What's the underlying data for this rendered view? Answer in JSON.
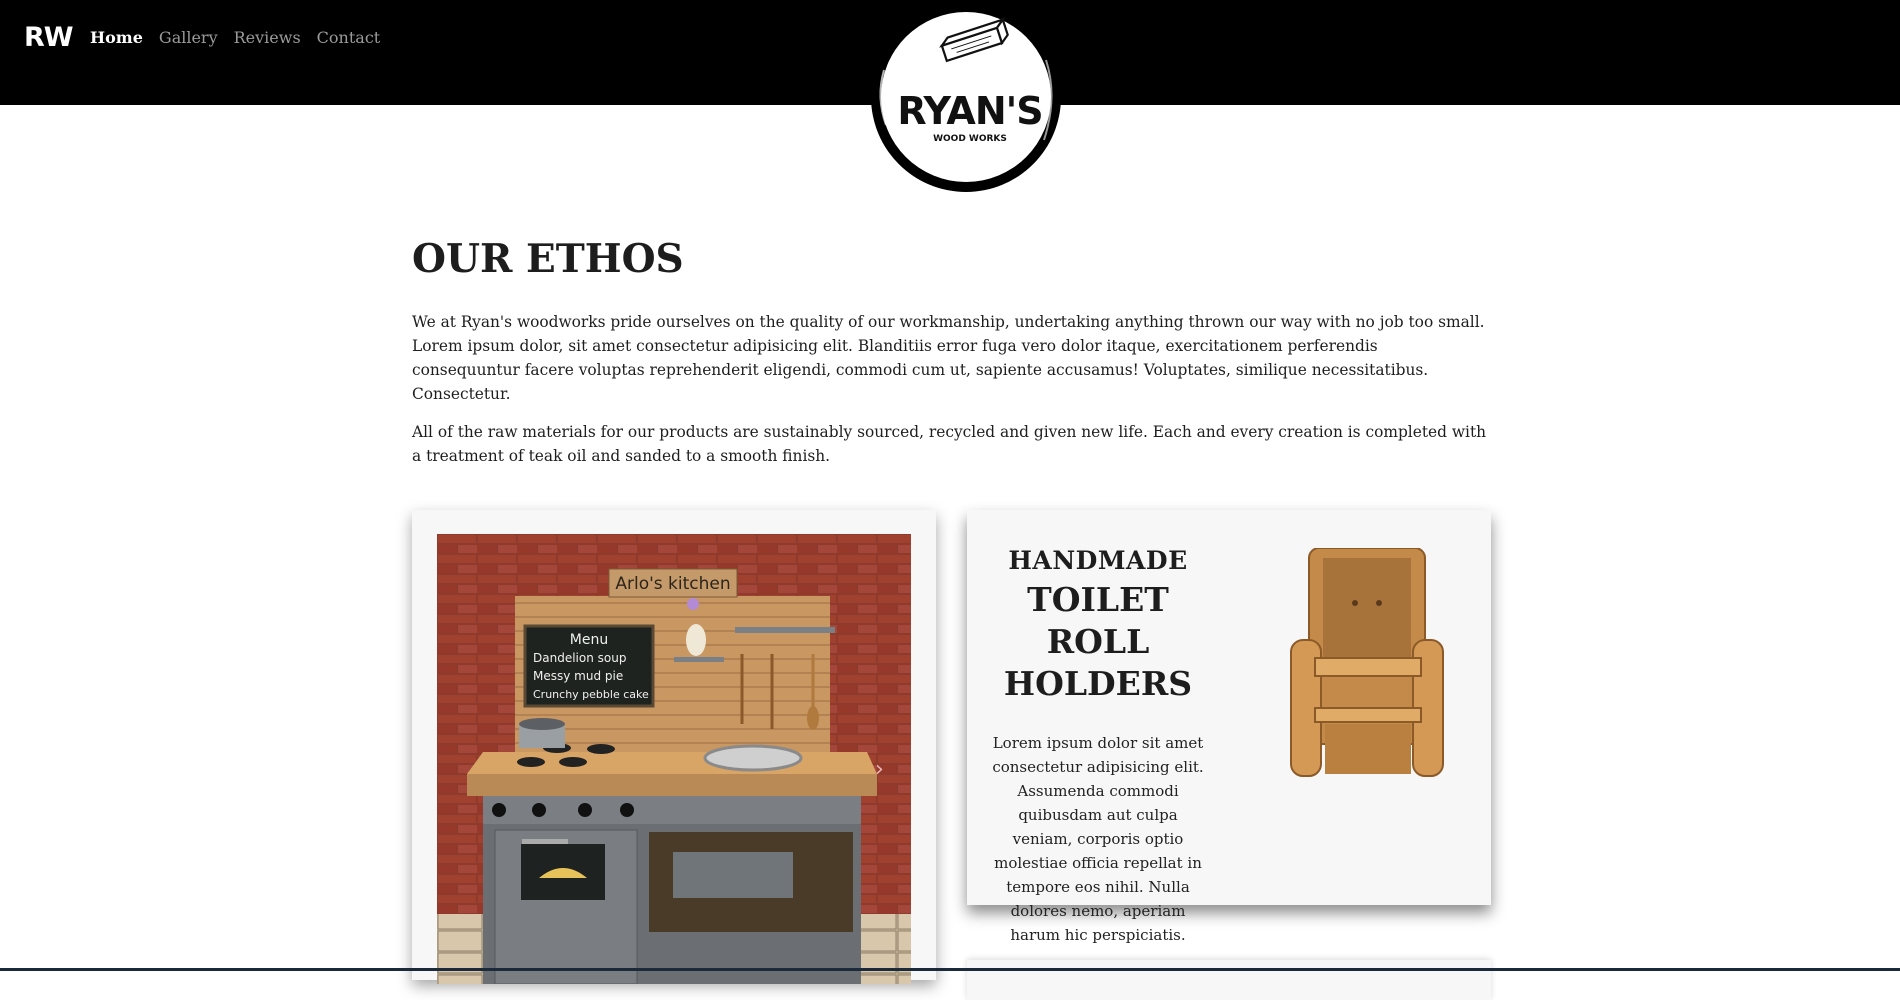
{
  "nav": {
    "brand": "RW",
    "links": [
      {
        "label": "Home",
        "active": true
      },
      {
        "label": "Gallery",
        "active": false
      },
      {
        "label": "Reviews",
        "active": false
      },
      {
        "label": "Contact",
        "active": false
      }
    ]
  },
  "logo": {
    "title": "RYAN'S",
    "subtitle": "WOOD WORKS"
  },
  "ethos": {
    "heading": "OUR ETHOS",
    "paragraphs": [
      "We at Ryan's woodworks pride ourselves on the quality of our workmanship, undertaking anything thrown our way with no job too small. Lorem ipsum dolor, sit amet consectetur adipisicing elit. Blanditiis error fuga vero dolor itaque, exercitationem perferendis consequuntur facere voluptas reprehenderit eligendi, commodi cum ut, sapiente accusamus! Voluptates, similique necessitatibus. Consectetur.",
      "All of the raw materials for our products are sustainably sourced, recycled and given new life. Each and every creation is completed with a treatment of teak oil and sanded to a smooth finish."
    ]
  },
  "kitchen_photo": {
    "sign": "Arlo's kitchen",
    "menu_title": "Menu",
    "menu_items": [
      "Dandelion soup",
      "Messy mud pie",
      "Crunchy pebble cake"
    ],
    "carousel_next_icon": "chevron-right-icon"
  },
  "product": {
    "kicker": "HANDMADE",
    "title": "TOILET ROLL HOLDERS",
    "description": "Lorem ipsum dolor sit amet consectetur adipisicing elit. Assumenda commodi quibusdam aut culpa veniam, corporis optio molestiae officia repellat in tempore eos nihil. Nulla dolores nemo, aperiam harum hic perspiciatis."
  }
}
